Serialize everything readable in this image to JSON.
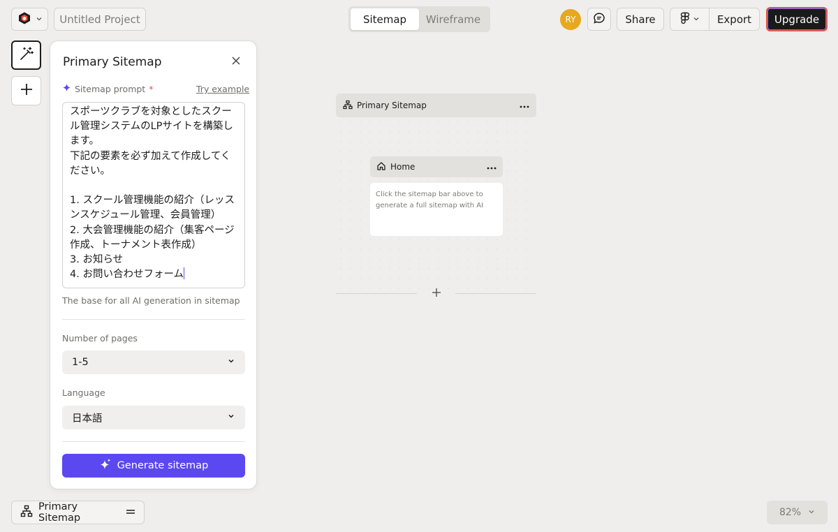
{
  "topbar": {
    "project_name": "Untitled Project",
    "tabs": [
      {
        "label": "Sitemap",
        "active": true
      },
      {
        "label": "Wireframe",
        "active": false
      }
    ],
    "avatar_initials": "RY",
    "avatar_color": "#e6a81e",
    "share_label": "Share",
    "export_label": "Export",
    "upgrade_label": "Upgrade",
    "icons": [
      "app-logo-icon",
      "chevron-down-icon",
      "comment-icon",
      "figma-icon"
    ]
  },
  "toolbar": {
    "icons": [
      "magic-wand-icon",
      "plus-icon"
    ]
  },
  "panel": {
    "title": "Primary Sitemap",
    "prompt_label": "Sitemap prompt",
    "required_mark": "*",
    "try_example": "Try example",
    "prompt_text": "スポーツクラブを対象としたスクール管理システムのLPサイトを構築します。\n下記の要素を必ず加えて作成してください。\n\n1. スクール管理機能の紹介（レッスンスケジュール管理、会員管理）\n2. 大会管理機能の紹介（集客ページ作成、トーナメント表作成）\n3. お知らせ\n4. お問い合わせフォーム",
    "prompt_hint": "The base for all AI generation in sitemap",
    "pages_label": "Number of pages",
    "pages_value": "1-5",
    "language_label": "Language",
    "language_value": "日本語",
    "generate_label": "Generate sitemap",
    "accent_color": "#5b48f0"
  },
  "canvas": {
    "sitemap_title": "Primary Sitemap",
    "home_title": "Home",
    "home_hint": "Click the sitemap bar above to generate a full sitemap with AI"
  },
  "bottom": {
    "sitemap_label": "Primary Sitemap",
    "zoom": "82%"
  }
}
